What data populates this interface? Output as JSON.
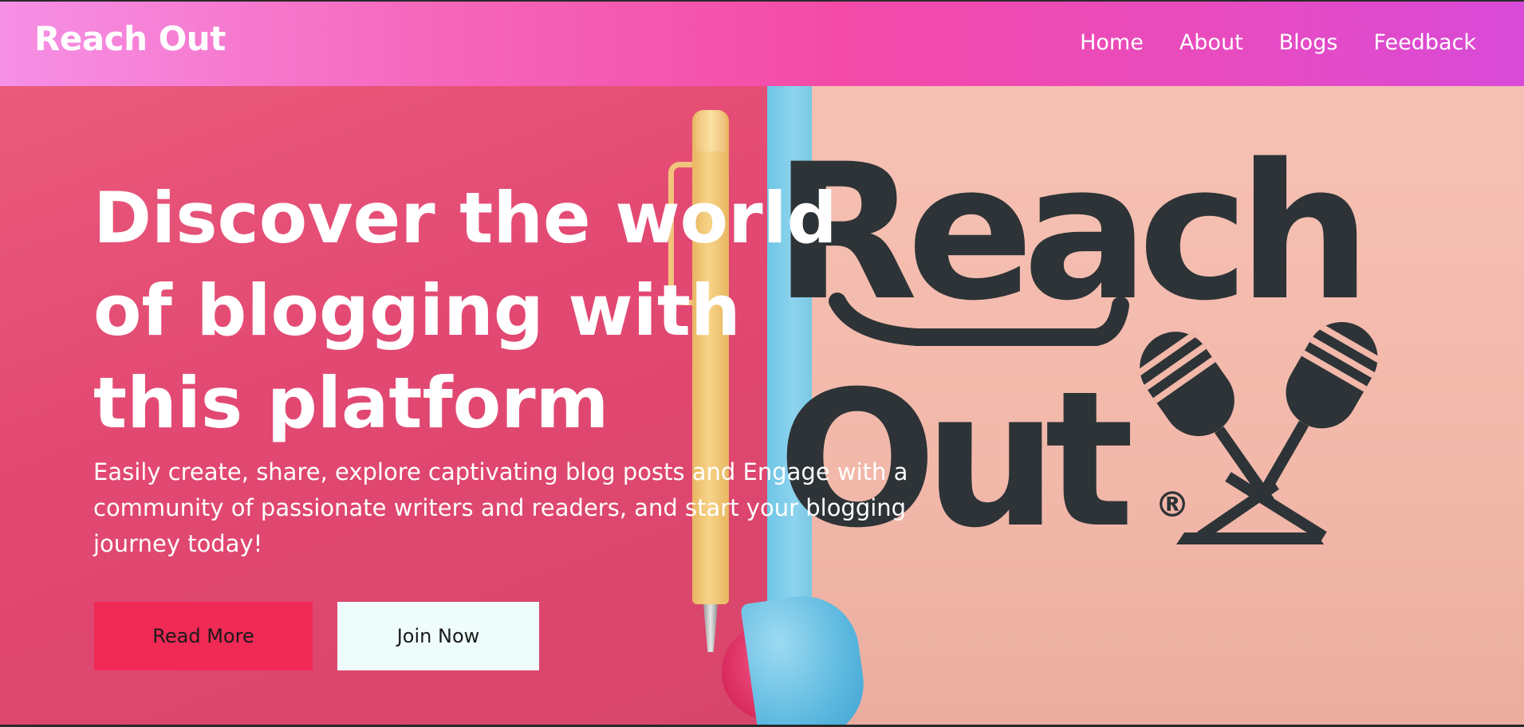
{
  "navbar": {
    "brand": "Reach Out",
    "links": [
      "Home",
      "About",
      "Blogs",
      "Feedback"
    ]
  },
  "hero": {
    "title": "Discover the world of blogging with this platform",
    "description": "Easily create, share, explore captivating blog posts and Engage with a community of passionate writers and readers, and start your blogging journey today!",
    "buttons": {
      "read_more": "Read More",
      "join_now": "Join Now"
    },
    "logo_text": [
      "Reach",
      "Out"
    ],
    "logo_mark": "®"
  },
  "colors": {
    "nav_gradient_start": "#f690e6",
    "nav_gradient_end": "#d84ad8",
    "hero_left_bg": "#e24872",
    "hero_right_bg": "#f2b8aa",
    "read_more_bg": "#f02a55",
    "join_now_bg": "#eefcfb",
    "logo_color": "#2d3336"
  },
  "icons": [
    "pen-icon",
    "microphones-icon"
  ]
}
